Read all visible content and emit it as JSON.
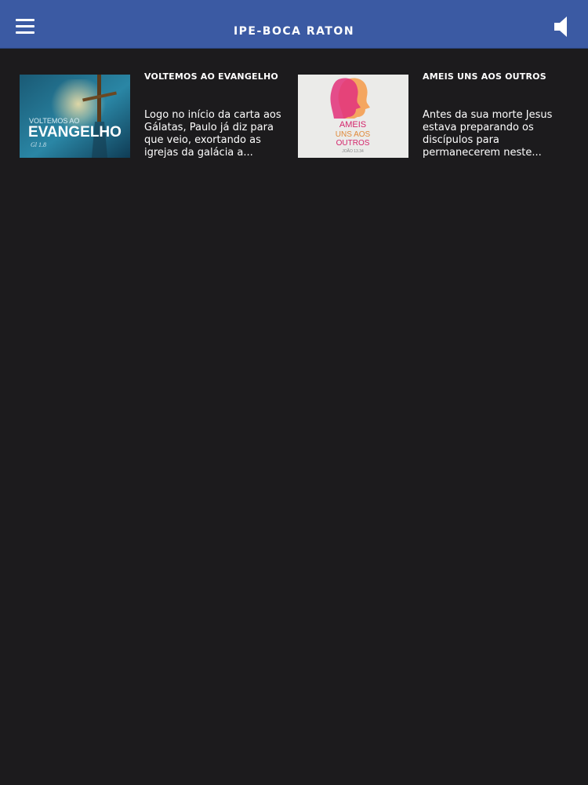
{
  "header": {
    "title": "IPE-BOCA RATON",
    "menu_icon": "hamburger-menu-icon",
    "sound_icon": "speaker-icon",
    "background_color": "#3b5aa3"
  },
  "posts": [
    {
      "title": "VOLTEMOS AO EVANGELHO",
      "excerpt": "Logo no início da carta aos Gálatas, Paulo já diz para que veio, exortando as igrejas da galácia a...",
      "thumbnail": {
        "line1": "VOLTEMOS AO",
        "line2": "EVANGELHO",
        "line3": "Gl 1.8"
      }
    },
    {
      "title": "AMEIS UNS AOS OUTROS",
      "excerpt": "Antes da sua morte Jesus estava preparando os discípulos para permanecerem neste...",
      "thumbnail": {
        "line1": "AMEIS",
        "line2": "UNS AOS",
        "line3": "OUTROS",
        "line4": "JOÃO 13.34"
      }
    }
  ]
}
